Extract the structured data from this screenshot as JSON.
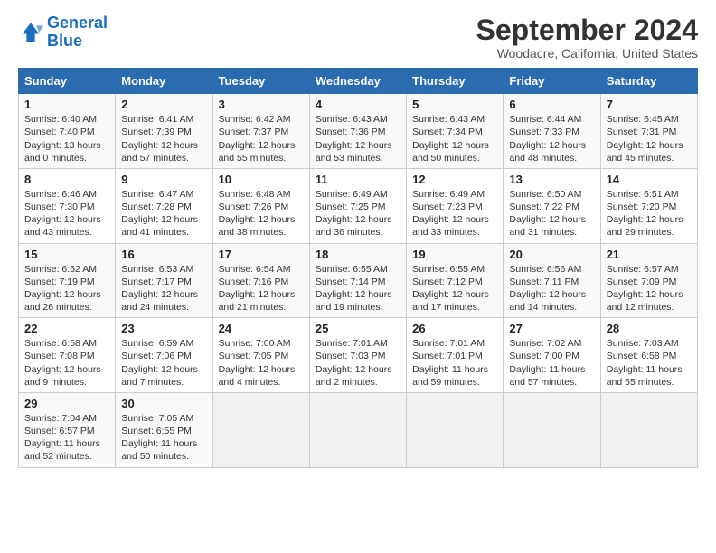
{
  "app": {
    "logo_general": "General",
    "logo_blue": "Blue",
    "month": "September 2024",
    "location": "Woodacre, California, United States"
  },
  "calendar": {
    "headers": [
      "Sunday",
      "Monday",
      "Tuesday",
      "Wednesday",
      "Thursday",
      "Friday",
      "Saturday"
    ],
    "weeks": [
      [
        {
          "day": "",
          "empty": true
        },
        {
          "day": "",
          "empty": true
        },
        {
          "day": "",
          "empty": true
        },
        {
          "day": "",
          "empty": true
        },
        {
          "day": "5",
          "sunrise": "Sunrise: 6:43 AM",
          "sunset": "Sunset: 7:34 PM",
          "daylight": "Daylight: 12 hours and 50 minutes."
        },
        {
          "day": "6",
          "sunrise": "Sunrise: 6:44 AM",
          "sunset": "Sunset: 7:33 PM",
          "daylight": "Daylight: 12 hours and 48 minutes."
        },
        {
          "day": "7",
          "sunrise": "Sunrise: 6:45 AM",
          "sunset": "Sunset: 7:31 PM",
          "daylight": "Daylight: 12 hours and 45 minutes."
        }
      ],
      [
        {
          "day": "1",
          "sunrise": "Sunrise: 6:40 AM",
          "sunset": "Sunset: 7:40 PM",
          "daylight": "Daylight: 13 hours and 0 minutes."
        },
        {
          "day": "2",
          "sunrise": "Sunrise: 6:41 AM",
          "sunset": "Sunset: 7:39 PM",
          "daylight": "Daylight: 12 hours and 57 minutes."
        },
        {
          "day": "3",
          "sunrise": "Sunrise: 6:42 AM",
          "sunset": "Sunset: 7:37 PM",
          "daylight": "Daylight: 12 hours and 55 minutes."
        },
        {
          "day": "4",
          "sunrise": "Sunrise: 6:43 AM",
          "sunset": "Sunset: 7:36 PM",
          "daylight": "Daylight: 12 hours and 53 minutes."
        },
        {
          "day": "5",
          "sunrise": "Sunrise: 6:43 AM",
          "sunset": "Sunset: 7:34 PM",
          "daylight": "Daylight: 12 hours and 50 minutes."
        },
        {
          "day": "6",
          "sunrise": "Sunrise: 6:44 AM",
          "sunset": "Sunset: 7:33 PM",
          "daylight": "Daylight: 12 hours and 48 minutes."
        },
        {
          "day": "7",
          "sunrise": "Sunrise: 6:45 AM",
          "sunset": "Sunset: 7:31 PM",
          "daylight": "Daylight: 12 hours and 45 minutes."
        }
      ],
      [
        {
          "day": "8",
          "sunrise": "Sunrise: 6:46 AM",
          "sunset": "Sunset: 7:30 PM",
          "daylight": "Daylight: 12 hours and 43 minutes."
        },
        {
          "day": "9",
          "sunrise": "Sunrise: 6:47 AM",
          "sunset": "Sunset: 7:28 PM",
          "daylight": "Daylight: 12 hours and 41 minutes."
        },
        {
          "day": "10",
          "sunrise": "Sunrise: 6:48 AM",
          "sunset": "Sunset: 7:26 PM",
          "daylight": "Daylight: 12 hours and 38 minutes."
        },
        {
          "day": "11",
          "sunrise": "Sunrise: 6:49 AM",
          "sunset": "Sunset: 7:25 PM",
          "daylight": "Daylight: 12 hours and 36 minutes."
        },
        {
          "day": "12",
          "sunrise": "Sunrise: 6:49 AM",
          "sunset": "Sunset: 7:23 PM",
          "daylight": "Daylight: 12 hours and 33 minutes."
        },
        {
          "day": "13",
          "sunrise": "Sunrise: 6:50 AM",
          "sunset": "Sunset: 7:22 PM",
          "daylight": "Daylight: 12 hours and 31 minutes."
        },
        {
          "day": "14",
          "sunrise": "Sunrise: 6:51 AM",
          "sunset": "Sunset: 7:20 PM",
          "daylight": "Daylight: 12 hours and 29 minutes."
        }
      ],
      [
        {
          "day": "15",
          "sunrise": "Sunrise: 6:52 AM",
          "sunset": "Sunset: 7:19 PM",
          "daylight": "Daylight: 12 hours and 26 minutes."
        },
        {
          "day": "16",
          "sunrise": "Sunrise: 6:53 AM",
          "sunset": "Sunset: 7:17 PM",
          "daylight": "Daylight: 12 hours and 24 minutes."
        },
        {
          "day": "17",
          "sunrise": "Sunrise: 6:54 AM",
          "sunset": "Sunset: 7:16 PM",
          "daylight": "Daylight: 12 hours and 21 minutes."
        },
        {
          "day": "18",
          "sunrise": "Sunrise: 6:55 AM",
          "sunset": "Sunset: 7:14 PM",
          "daylight": "Daylight: 12 hours and 19 minutes."
        },
        {
          "day": "19",
          "sunrise": "Sunrise: 6:55 AM",
          "sunset": "Sunset: 7:12 PM",
          "daylight": "Daylight: 12 hours and 17 minutes."
        },
        {
          "day": "20",
          "sunrise": "Sunrise: 6:56 AM",
          "sunset": "Sunset: 7:11 PM",
          "daylight": "Daylight: 12 hours and 14 minutes."
        },
        {
          "day": "21",
          "sunrise": "Sunrise: 6:57 AM",
          "sunset": "Sunset: 7:09 PM",
          "daylight": "Daylight: 12 hours and 12 minutes."
        }
      ],
      [
        {
          "day": "22",
          "sunrise": "Sunrise: 6:58 AM",
          "sunset": "Sunset: 7:08 PM",
          "daylight": "Daylight: 12 hours and 9 minutes."
        },
        {
          "day": "23",
          "sunrise": "Sunrise: 6:59 AM",
          "sunset": "Sunset: 7:06 PM",
          "daylight": "Daylight: 12 hours and 7 minutes."
        },
        {
          "day": "24",
          "sunrise": "Sunrise: 7:00 AM",
          "sunset": "Sunset: 7:05 PM",
          "daylight": "Daylight: 12 hours and 4 minutes."
        },
        {
          "day": "25",
          "sunrise": "Sunrise: 7:01 AM",
          "sunset": "Sunset: 7:03 PM",
          "daylight": "Daylight: 12 hours and 2 minutes."
        },
        {
          "day": "26",
          "sunrise": "Sunrise: 7:01 AM",
          "sunset": "Sunset: 7:01 PM",
          "daylight": "Daylight: 11 hours and 59 minutes."
        },
        {
          "day": "27",
          "sunrise": "Sunrise: 7:02 AM",
          "sunset": "Sunset: 7:00 PM",
          "daylight": "Daylight: 11 hours and 57 minutes."
        },
        {
          "day": "28",
          "sunrise": "Sunrise: 7:03 AM",
          "sunset": "Sunset: 6:58 PM",
          "daylight": "Daylight: 11 hours and 55 minutes."
        }
      ],
      [
        {
          "day": "29",
          "sunrise": "Sunrise: 7:04 AM",
          "sunset": "Sunset: 6:57 PM",
          "daylight": "Daylight: 11 hours and 52 minutes."
        },
        {
          "day": "30",
          "sunrise": "Sunrise: 7:05 AM",
          "sunset": "Sunset: 6:55 PM",
          "daylight": "Daylight: 11 hours and 50 minutes."
        },
        {
          "day": "",
          "empty": true
        },
        {
          "day": "",
          "empty": true
        },
        {
          "day": "",
          "empty": true
        },
        {
          "day": "",
          "empty": true
        },
        {
          "day": "",
          "empty": true
        }
      ]
    ]
  }
}
